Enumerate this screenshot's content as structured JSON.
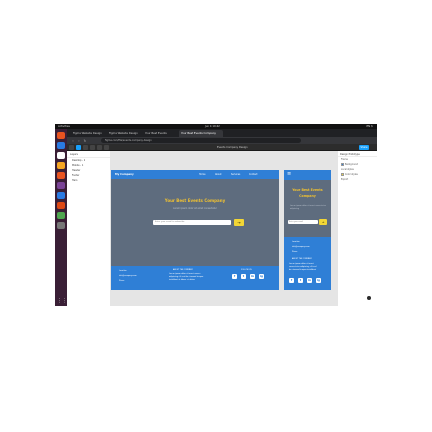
{
  "topbar": {
    "activities": "Activities",
    "clock": "Jun 4 10:42",
    "tray": "EN  ⏻"
  },
  "dock": {
    "icons": [
      "#e95420",
      "#2a7ae2",
      "#ffffff",
      "#f6a623",
      "#e95420",
      "#7b4397",
      "#2a7ae2",
      "#dd4814",
      "#4fa64f",
      "#777777"
    ],
    "apps_glyph": "⋮⋮"
  },
  "chrome": {
    "tabs": [
      "Figma Website Design",
      "Figma Website Design",
      "Your Best Events",
      "Your Best Events Company"
    ],
    "url": "figma.com/file/events-company-design"
  },
  "figma": {
    "file_name": "Events Company Design",
    "share_label": "Share",
    "layers_header": "Layers",
    "layers": [
      "Desktop - 1",
      "Mobile - 1",
      "Header",
      "Footer",
      "Hero"
    ],
    "props_tabs": "Design  Prototype",
    "props_rows": [
      "Frame",
      "Background",
      "Local styles",
      "Color styles",
      "Export"
    ],
    "swatch_colors": [
      "#2f7fd6",
      "#f2d635",
      "#5e6c7e"
    ]
  },
  "desktop": {
    "logo": "My Company",
    "nav": [
      "Home",
      "About",
      "Services",
      "Contact"
    ],
    "title": "Your Best Events Company",
    "subtitle": "Lorem ipsum dolor sit amet consectetur",
    "input_placeholder": "Enter your email to subscribe",
    "button_glyph": "→",
    "footer": {
      "contacts": [
        "Location",
        "info@company.com",
        "Phone"
      ],
      "about_title": "ABOUT THE COMPANY",
      "about_text": [
        "Lorem ipsum dolor sit amet consec",
        "adipiscing elit sed do eiusmod tempor",
        "incididunt ut labore et dolore"
      ],
      "follow": "FOLLOW US",
      "social": [
        "f",
        "t",
        "in",
        "ig"
      ]
    }
  },
  "mobile": {
    "burger": "≡",
    "title": "Your Best Events Company",
    "subtitle": "Lorem ipsum dolor sit amet consectetur adipiscing",
    "input_placeholder": "Enter your email",
    "button_glyph": "→",
    "footer": {
      "contacts": [
        "Location",
        "info@company.com",
        "Phone"
      ],
      "about_title": "ABOUT THE COMPANY",
      "about_text": [
        "Lorem ipsum dolor sit amet",
        "consectetur adipiscing elit sed",
        "do eiusmod tempor incididunt"
      ],
      "social": [
        "f",
        "t",
        "in",
        "ig"
      ]
    }
  }
}
